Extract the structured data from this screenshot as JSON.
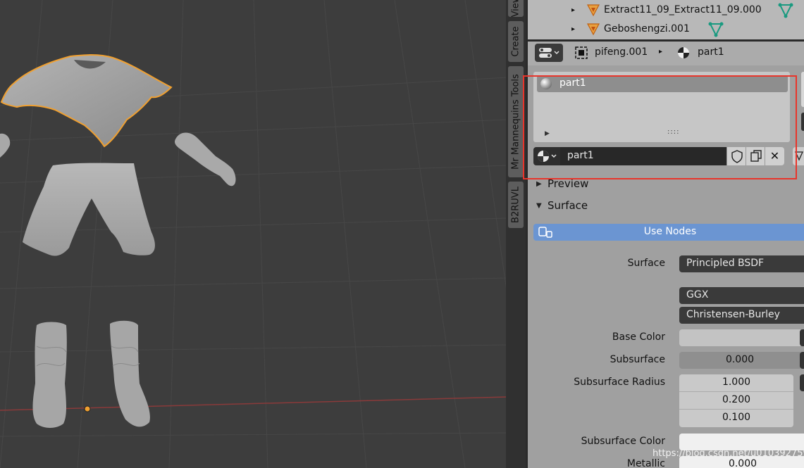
{
  "vertical_tabs": [
    "View",
    "Create",
    "Mr Mannequins Tools",
    "B2RUVL"
  ],
  "outliner": {
    "items": [
      {
        "name": "Extract11_09_Extract11_09.000"
      },
      {
        "name": "Geboshengzi.001"
      }
    ]
  },
  "breadcrumb": {
    "object": "pifeng.001",
    "material": "part1"
  },
  "material_slots": {
    "items": [
      {
        "name": "part1"
      }
    ]
  },
  "material_field": {
    "name": "part1"
  },
  "sections": {
    "preview": "Preview",
    "surface": "Surface"
  },
  "use_nodes": "Use Nodes",
  "properties": {
    "surface_label": "Surface",
    "surface_value": "Principled BSDF",
    "distribution": "GGX",
    "subsurface_method": "Christensen-Burley",
    "base_color_label": "Base Color",
    "subsurface_label": "Subsurface",
    "subsurface_value": "0.000",
    "subsurface_radius_label": "Subsurface Radius",
    "subsurface_radius": [
      "1.000",
      "0.200",
      "0.100"
    ],
    "subsurface_color_label": "Subsurface Color",
    "metallic_label": "Metallic",
    "metallic_value": "0.000"
  },
  "watermark": "https://blog.csdn.net/u010392759",
  "colors": {
    "selection_outline": "#f0a030",
    "highlight_box": "#e8352b",
    "use_nodes_blue": "#6b95d2"
  }
}
